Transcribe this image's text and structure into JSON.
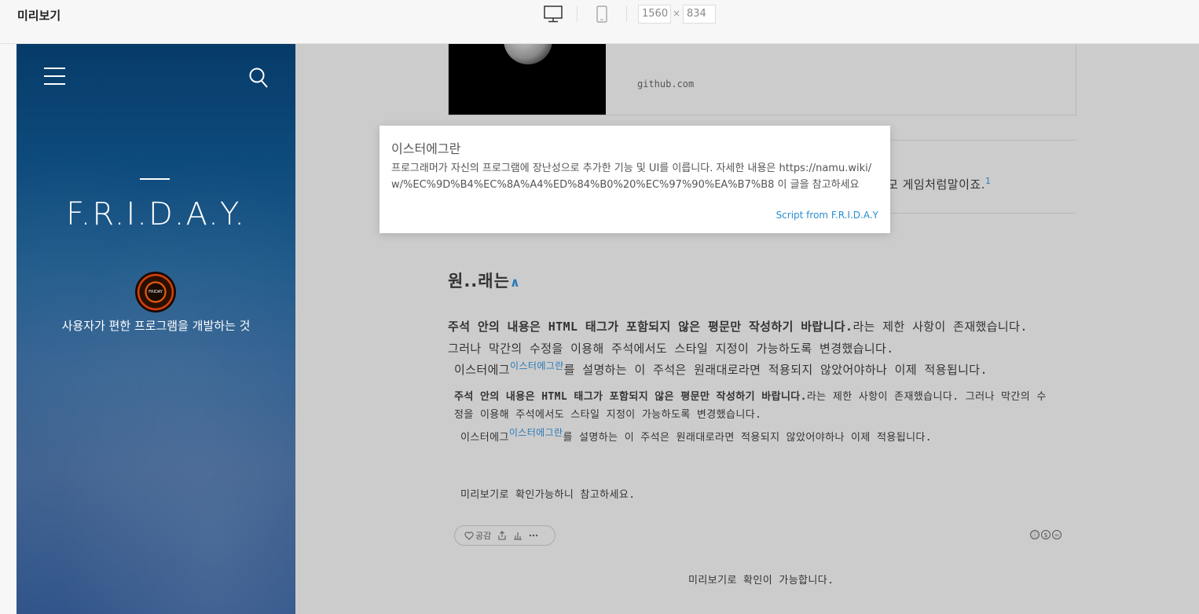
{
  "topbar": {
    "title": "미리보기",
    "width_value": "1560",
    "times": "×",
    "height_value": "834"
  },
  "sidebar": {
    "brand": "F.R.I.D.A.Y.",
    "avatar_text": "FRIDAY",
    "tagline": "사용자가 편한 프로그램을 개발하는 것"
  },
  "main": {
    "card_url": "github.com",
    "behind_text": "모 게임처럼말이죠.",
    "behind_note": "1",
    "heading": "원..래는",
    "heading_caret": "∧",
    "p1_bold": "주석 안의 내용은 HTML 태그가 포함되지 않은 평문만 작성하기 바랍니다.",
    "p1_rest": "라는 제한 사항이 존재했습니다.",
    "p1_line2": "그러나 막간의 수정을 이용해 주석에서도 스타일 지정이 가능하도록 변경했습니다.",
    "p2_pre": "이스터에그",
    "p2_note": "이스터에그란",
    "p2_post": "를 설명하는 이 주석은 원래대로라면 적용되지 않았어야하나 이제 적용됩니다.",
    "p3_bold": "주석 안의 내용은 HTML 태그가 포함되지 않은 평문만 작성하기 바랍니다.",
    "p3_rest": "라는 제한 사항이 존재했습니다. 그러나 막간의 수",
    "p3_line2": "정을 이용해 주석에서도 스타일 지정이 가능하도록 변경했습니다.",
    "p4_pre": "이스터에그",
    "p4_note": "이스터에그란",
    "p4_post": "를 설명하는 이 주석은 원래대로라면 적용되지 않았어야하나 이제 적용됩니다.",
    "p5": "미리보기로 확인가능하니 참고하세요.",
    "like_label": "공감",
    "footer_note": "미리보기로 확인이 가능합니다."
  },
  "tooltip": {
    "title": "이스터에그란",
    "body": "프로그래머가 자신의 프로그램에 장난성으로 추가한 기능 및 UI를 이릅니다. 자세한 내용은 https://namu.wiki/w/%EC%9D%B4%EC%8A%A4%ED%84%B0%20%EC%97%90%EA%B7%B8 이 글을 참고하세요",
    "source": "Script from F.R.I.D.A.Y"
  },
  "colors": {
    "accent": "#2a7ab8",
    "sidebar_top": "#063b68",
    "main_bg": "#cccccc"
  }
}
